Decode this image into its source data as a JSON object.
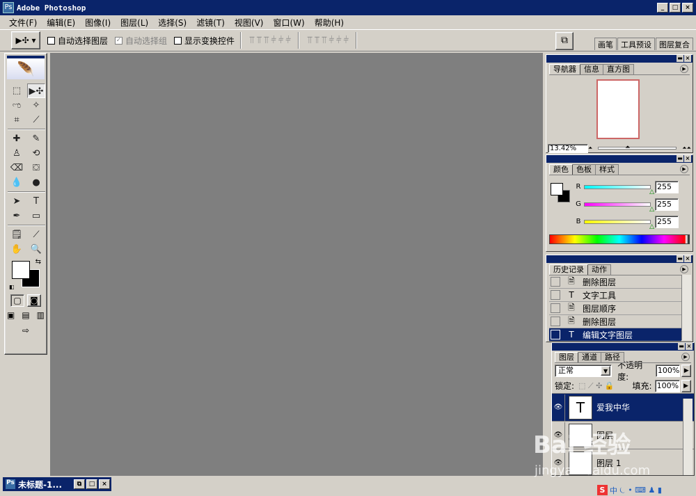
{
  "app": {
    "title": "Adobe Photoshop",
    "icon": "photoshop-icon",
    "window_buttons": {
      "minimize": "_",
      "maximize": "□",
      "close": "×"
    }
  },
  "menu": [
    {
      "label": "文件(F)"
    },
    {
      "label": "编辑(E)"
    },
    {
      "label": "图像(I)"
    },
    {
      "label": "图层(L)"
    },
    {
      "label": "选择(S)"
    },
    {
      "label": "滤镜(T)"
    },
    {
      "label": "视图(V)"
    },
    {
      "label": "窗口(W)"
    },
    {
      "label": "帮助(H)"
    }
  ],
  "options": {
    "tool_preset_glyph": "▶✣ ▾",
    "auto_select_layer": {
      "label": "自动选择图层",
      "checked": false
    },
    "auto_select_group": {
      "label": "自动选择组",
      "checked": true,
      "disabled": true
    },
    "show_transform": {
      "label": "显示变换控件",
      "checked": false
    },
    "align_icons_1": "⫪ ⫪ ⫪  ⫩ ⫩ ⫩",
    "align_icons_2": "⫪ ⫪ ⫪  ⫩ ⫩ ⫩",
    "file_browser_glyph": "⧉",
    "palette_well_tabs": [
      "画笔",
      "工具预设",
      "图层复合"
    ]
  },
  "toolbox": {
    "feather_glyph": "🪶",
    "tools": [
      {
        "name": "marquee-tool-icon",
        "glyph": "⬚"
      },
      {
        "name": "move-tool-icon",
        "glyph": "▶✣",
        "active": true
      },
      {
        "name": "lasso-tool-icon",
        "glyph": "ಌ"
      },
      {
        "name": "magic-wand-tool-icon",
        "glyph": "✧"
      },
      {
        "name": "crop-tool-icon",
        "glyph": "⌗"
      },
      {
        "name": "slice-tool-icon",
        "glyph": "⟋"
      },
      {
        "name": "healing-brush-tool-icon",
        "glyph": "✚"
      },
      {
        "name": "brush-tool-icon",
        "glyph": "✎"
      },
      {
        "name": "clone-stamp-tool-icon",
        "glyph": "♙"
      },
      {
        "name": "history-brush-tool-icon",
        "glyph": "⟲"
      },
      {
        "name": "eraser-tool-icon",
        "glyph": "⌫"
      },
      {
        "name": "paint-bucket-tool-icon",
        "glyph": "⛋"
      },
      {
        "name": "blur-tool-icon",
        "glyph": "💧"
      },
      {
        "name": "dodge-tool-icon",
        "glyph": "●"
      },
      {
        "name": "path-selection-tool-icon",
        "glyph": "➤"
      },
      {
        "name": "type-tool-icon",
        "glyph": "T"
      },
      {
        "name": "pen-tool-icon",
        "glyph": "✒"
      },
      {
        "name": "rectangle-tool-icon",
        "glyph": "▭"
      },
      {
        "name": "notes-tool-icon",
        "glyph": "🗒"
      },
      {
        "name": "eyedropper-tool-icon",
        "glyph": "⟋"
      },
      {
        "name": "hand-tool-icon",
        "glyph": "✋"
      },
      {
        "name": "zoom-tool-icon",
        "glyph": "🔍"
      }
    ],
    "swap_glyph": "⇆",
    "default_colors_glyph": "◧",
    "mode_standard_glyph": "▢",
    "mode_quickmask_glyph": "◙",
    "screen_mode_glyphs": [
      "▣",
      "▤",
      "▥"
    ],
    "jump_glyph": "⇨"
  },
  "navigator": {
    "tabs": [
      "导航器",
      "信息",
      "直方图"
    ],
    "zoom": "13.42%",
    "zoom_out_glyph": "⏶",
    "zoom_in_glyph": "⏶⏶"
  },
  "color_panel": {
    "tabs": [
      "颜色",
      "色板",
      "样式"
    ],
    "channels": [
      {
        "label": "R",
        "value": "255",
        "gradient": "linear-gradient(90deg,#0ff,#fff)"
      },
      {
        "label": "G",
        "value": "255",
        "gradient": "linear-gradient(90deg,#f0f,#fff)"
      },
      {
        "label": "B",
        "value": "255",
        "gradient": "linear-gradient(90deg,#ff0,#fff)"
      }
    ]
  },
  "history_panel": {
    "tabs": [
      "历史记录",
      "动作"
    ],
    "items": [
      {
        "icon": "document-icon",
        "glyph": "🗎",
        "label": "删除图层",
        "selected": false
      },
      {
        "icon": "type-tool-icon",
        "glyph": "T",
        "label": "文字工具",
        "selected": false
      },
      {
        "icon": "document-icon",
        "glyph": "🗎",
        "label": "图层顺序",
        "selected": false
      },
      {
        "icon": "document-icon",
        "glyph": "🗎",
        "label": "删除图层",
        "selected": false
      },
      {
        "icon": "type-tool-icon",
        "glyph": "T",
        "label": "编辑文字图层",
        "selected": true
      }
    ]
  },
  "layers_panel": {
    "tabs": [
      "图层",
      "通道",
      "路径"
    ],
    "blend_mode": "正常",
    "opacity_label": "不透明度:",
    "opacity": "100%",
    "lock_label": "锁定:",
    "lock_icons": "⬚ ⟋ ✣ 🔒",
    "fill_label": "填充:",
    "fill": "100%",
    "layers": [
      {
        "name": "爱我中华",
        "thumb": "T",
        "selected": true
      },
      {
        "name": "图层",
        "thumb": "",
        "selected": false
      },
      {
        "name": "图层 1",
        "thumb": "",
        "selected": false
      }
    ]
  },
  "document_tab": {
    "title": "未标题-1..."
  },
  "watermark": {
    "text": "Bai 经验",
    "url": "jingyan.baidu.com"
  },
  "ime": {
    "label": "中",
    "glyphs": "⏾ • ⌨ ♟ ▮"
  }
}
